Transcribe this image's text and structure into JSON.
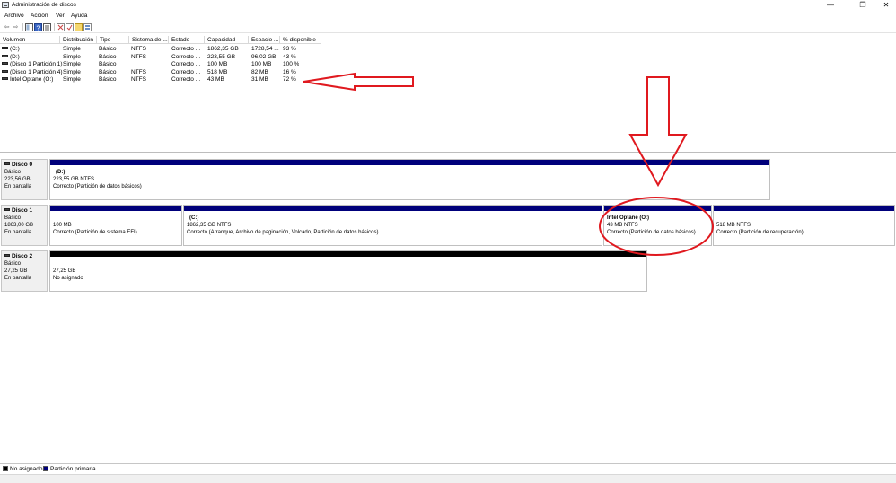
{
  "window": {
    "title": "Administración de discos",
    "minimize_glyph": "—",
    "restore_glyph": "❐",
    "close_glyph": "✕"
  },
  "menu": {
    "items": [
      "Archivo",
      "Acción",
      "Ver",
      "Ayuda"
    ]
  },
  "toolbar": {
    "icons": [
      "back-arrow-icon",
      "forward-arrow-icon",
      "console-tree-icon",
      "help-icon",
      "properties-list-icon",
      "check-icon",
      "new-icon",
      "delete-icon",
      "view-icon"
    ]
  },
  "volume_table": {
    "columns": [
      "Volumen",
      "Distribución",
      "Tipo",
      "Sistema de ...",
      "Estado",
      "Capacidad",
      "Espacio ...",
      "% disponible"
    ],
    "rows": [
      {
        "volumen": "(C:)",
        "distribucion": "Simple",
        "tipo": "Básico",
        "sistema": "NTFS",
        "estado": "Correcto ...",
        "capacidad": "1862,35 GB",
        "espacio": "1728,54 ...",
        "disponible": "93 %"
      },
      {
        "volumen": "(D:)",
        "distribucion": "Simple",
        "tipo": "Básico",
        "sistema": "NTFS",
        "estado": "Correcto ...",
        "capacidad": "223,55 GB",
        "espacio": "96,02 GB",
        "disponible": "43 %"
      },
      {
        "volumen": "(Disco 1 Partición 1)",
        "distribucion": "Simple",
        "tipo": "Básico",
        "sistema": "",
        "estado": "Correcto ...",
        "capacidad": "100 MB",
        "espacio": "100 MB",
        "disponible": "100 %"
      },
      {
        "volumen": "(Disco 1 Partición 4)",
        "distribucion": "Simple",
        "tipo": "Básico",
        "sistema": "NTFS",
        "estado": "Correcto ...",
        "capacidad": "518 MB",
        "espacio": "82 MB",
        "disponible": "16 %"
      },
      {
        "volumen": "Intel Optane (O:)",
        "distribucion": "Simple",
        "tipo": "Básico",
        "sistema": "NTFS",
        "estado": "Correcto ...",
        "capacidad": "43 MB",
        "espacio": "31 MB",
        "disponible": "72 %"
      }
    ]
  },
  "disks": [
    {
      "name": "Disco 0",
      "type": "Básico",
      "size": "223,56 GB",
      "status": "En pantalla",
      "partitions": [
        {
          "name": "(D:)",
          "size": "223,55 GB NTFS",
          "status": "Correcto (Partición de datos básicos)"
        }
      ]
    },
    {
      "name": "Disco 1",
      "type": "Básico",
      "size": "1863,00 GB",
      "status": "En pantalla",
      "partitions": [
        {
          "name": "",
          "size": "100 MB",
          "status": "Correcto (Partición de sistema EFI)"
        },
        {
          "name": "(C:)",
          "size": "1862,35 GB NTFS",
          "status": "Correcto (Arranque, Archivo de paginación, Volcado, Partición de datos básicos)"
        },
        {
          "name": "Intel Optane  (O:)",
          "size": "43 MB NTFS",
          "status": "Correcto (Partición de datos básicos)"
        },
        {
          "name": "",
          "size": "518 MB NTFS",
          "status": "Correcto (Partición de recuperación)"
        }
      ]
    },
    {
      "name": "Disco 2",
      "type": "Básico",
      "size": "27,25 GB",
      "status": "En pantalla",
      "partitions": [
        {
          "name": "",
          "size": "27,25 GB",
          "status": "No asignado"
        }
      ]
    }
  ],
  "legend": {
    "items": [
      {
        "label": "No asignado",
        "color": "#000000"
      },
      {
        "label": "Partición primaria",
        "color": "#00007b"
      }
    ]
  },
  "annotation_color": "#e0191f"
}
